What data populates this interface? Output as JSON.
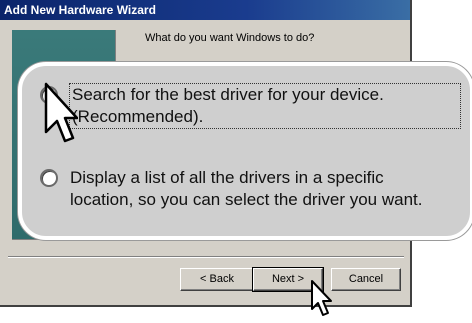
{
  "window": {
    "title": "Add New Hardware Wizard"
  },
  "prompt": "What do you want Windows to do?",
  "options": [
    {
      "line1": "Search for the best driver for your device.",
      "line2": "(Recommended).",
      "selected": true
    },
    {
      "line1": "Display a list of all the drivers in a specific",
      "line2": "location, so you can select the driver you want.",
      "selected": false
    }
  ],
  "buttons": {
    "back": "< Back",
    "next": "Next >",
    "cancel": "Cancel"
  },
  "colors": {
    "titlebar": "#0a246a",
    "dialog": "#d4d0c8",
    "callout": "#cfcfcf"
  }
}
